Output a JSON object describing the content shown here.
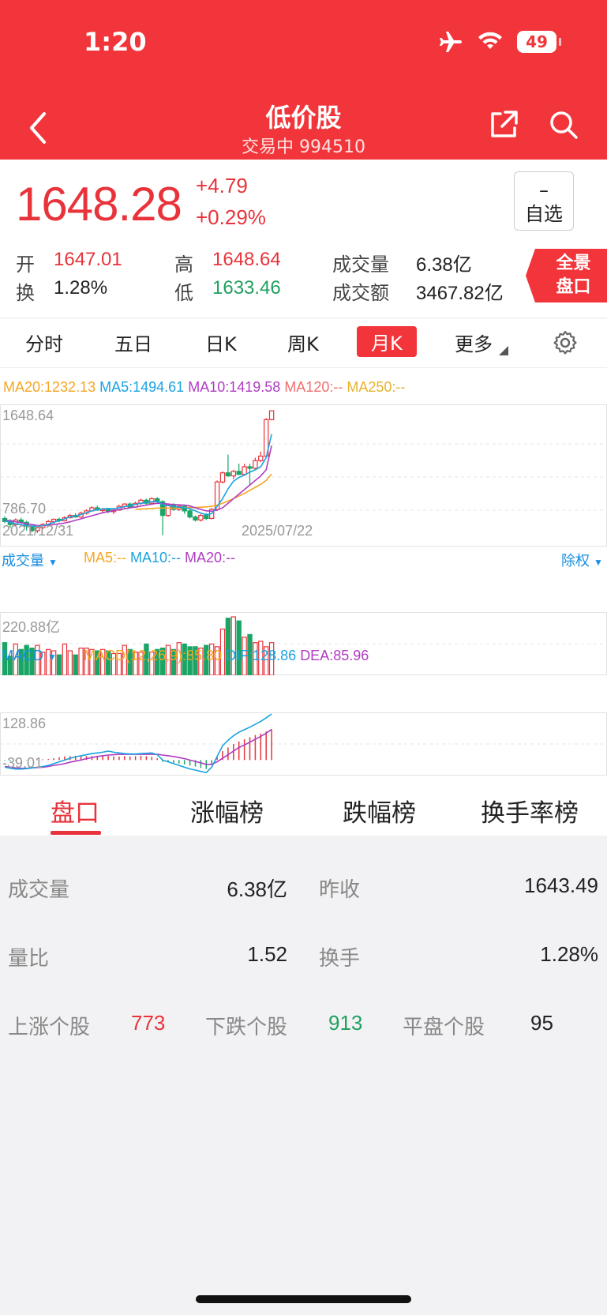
{
  "status": {
    "time": "1:20",
    "battery": "49"
  },
  "header": {
    "title": "低价股",
    "subtitle": "交易中 994510"
  },
  "quote": {
    "price": "1648.28",
    "change": "+4.79",
    "change_pct": "+0.29%",
    "watch_symbol": "–",
    "watch_label": "自选",
    "open_label": "开",
    "open": "1647.01",
    "turnover_label": "换",
    "turnover": "1.28%",
    "high_label": "高",
    "high": "1648.64",
    "low_label": "低",
    "low": "1633.46",
    "volume_label": "成交量",
    "volume": "6.38亿",
    "amount_label": "成交额",
    "amount": "3467.82亿",
    "panorama_line1": "全景",
    "panorama_line2": "盘口"
  },
  "tabs": [
    "分时",
    "五日",
    "日K",
    "周K",
    "月K",
    "更多"
  ],
  "active_tab": "月K",
  "chart_data": [
    {
      "type": "candlestick",
      "legend": [
        {
          "text": "MA20:1232.13",
          "color": "#f5a623"
        },
        {
          "text": "MA5:1494.61",
          "color": "#1aa3e0"
        },
        {
          "text": "MA10:1419.58",
          "color": "#b03cc2"
        },
        {
          "text": "MA120:--",
          "color": "#f07070"
        },
        {
          "text": "MA250:--",
          "color": "#e8b22c"
        }
      ],
      "y_max_label": "1648.64",
      "y_min_label": "786.70",
      "x_start": "2021/12/31",
      "x_end": "2025/07/22",
      "ylim": [
        786.7,
        1648.64
      ],
      "candles": [
        [
          940,
          920,
          955,
          910
        ],
        [
          925,
          900,
          935,
          880
        ],
        [
          900,
          930,
          940,
          890
        ],
        [
          930,
          915,
          945,
          905
        ],
        [
          915,
          890,
          925,
          860
        ],
        [
          890,
          860,
          900,
          850
        ],
        [
          860,
          880,
          890,
          845
        ],
        [
          880,
          900,
          910,
          870
        ],
        [
          900,
          920,
          930,
          895
        ],
        [
          920,
          935,
          940,
          905
        ],
        [
          935,
          925,
          945,
          915
        ],
        [
          925,
          945,
          955,
          920
        ],
        [
          945,
          960,
          970,
          940
        ],
        [
          960,
          950,
          975,
          945
        ],
        [
          950,
          975,
          985,
          945
        ],
        [
          975,
          990,
          1000,
          965
        ],
        [
          990,
          1010,
          1020,
          985
        ],
        [
          1010,
          995,
          1025,
          990
        ],
        [
          995,
          1000,
          1010,
          980
        ],
        [
          1000,
          985,
          1010,
          975
        ],
        [
          985,
          995,
          1005,
          970
        ],
        [
          995,
          1020,
          1030,
          990
        ],
        [
          1020,
          1035,
          1040,
          1005
        ],
        [
          1035,
          1015,
          1045,
          1010
        ],
        [
          1015,
          1040,
          1050,
          1010
        ],
        [
          1040,
          1060,
          1070,
          1030
        ],
        [
          1060,
          1040,
          1070,
          1030
        ],
        [
          1040,
          1070,
          1080,
          1035
        ],
        [
          1070,
          1050,
          1080,
          1040
        ],
        [
          1050,
          960,
          1060,
          830
        ],
        [
          960,
          1030,
          1040,
          950
        ],
        [
          1030,
          1000,
          1040,
          990
        ],
        [
          1000,
          1020,
          1030,
          990
        ],
        [
          1020,
          990,
          1030,
          970
        ],
        [
          990,
          950,
          1000,
          940
        ],
        [
          950,
          930,
          960,
          920
        ],
        [
          930,
          960,
          970,
          920
        ],
        [
          960,
          940,
          975,
          930
        ],
        [
          940,
          1000,
          1010,
          935
        ],
        [
          1000,
          1180,
          1190,
          990
        ],
        [
          1180,
          1240,
          1250,
          1170
        ],
        [
          1240,
          1220,
          1360,
          1215
        ],
        [
          1220,
          1250,
          1260,
          1200
        ],
        [
          1250,
          1230,
          1300,
          1225
        ],
        [
          1230,
          1280,
          1300,
          1220
        ],
        [
          1280,
          1270,
          1300,
          1160
        ],
        [
          1270,
          1320,
          1340,
          1260
        ],
        [
          1320,
          1350,
          1380,
          1310
        ],
        [
          1350,
          1590,
          1600,
          1340
        ],
        [
          1590,
          1648,
          1649,
          1585
        ]
      ],
      "ma5": [
        925,
        915,
        905,
        898,
        895,
        890,
        888,
        893,
        902,
        915,
        925,
        938,
        950,
        958,
        965,
        978,
        990,
        998,
        1003,
        1005,
        1004,
        1010,
        1018,
        1025,
        1032,
        1040,
        1045,
        1050,
        1055,
        1030,
        1025,
        1018,
        1015,
        1010,
        1005,
        990,
        975,
        965,
        972,
        1020,
        1070,
        1135,
        1185,
        1210,
        1225,
        1245,
        1260,
        1280,
        1340,
        1494.61
      ],
      "ma10": [
        930,
        925,
        918,
        912,
        905,
        900,
        895,
        894,
        896,
        900,
        905,
        910,
        918,
        928,
        938,
        948,
        958,
        968,
        978,
        985,
        992,
        998,
        1004,
        1010,
        1015,
        1022,
        1028,
        1034,
        1040,
        1038,
        1035,
        1032,
        1030,
        1028,
        1022,
        1010,
        1000,
        990,
        988,
        995,
        1010,
        1040,
        1070,
        1100,
        1130,
        1160,
        1190,
        1220,
        1260,
        1419.58
      ],
      "ma20": [
        null,
        null,
        null,
        null,
        null,
        null,
        null,
        null,
        null,
        null,
        null,
        null,
        null,
        null,
        null,
        null,
        null,
        null,
        null,
        null,
        null,
        null,
        null,
        null,
        1000,
        1002,
        1004,
        1006,
        1008,
        1008,
        1008,
        1008,
        1010,
        1012,
        1012,
        1012,
        1014,
        1016,
        1020,
        1028,
        1040,
        1055,
        1070,
        1088,
        1105,
        1125,
        1145,
        1165,
        1190,
        1232.13
      ]
    },
    {
      "type": "bar",
      "title": "成交量",
      "legend": [
        {
          "text": "MA5:--",
          "color": "#f5a623"
        },
        {
          "text": "MA10:--",
          "color": "#1aa3e0"
        },
        {
          "text": "MA20:--",
          "color": "#b03cc2"
        }
      ],
      "right_label": "除权",
      "y_max_label": "220.88亿",
      "ylim": [
        0,
        220.88
      ],
      "values": [
        120,
        70,
        115,
        95,
        110,
        100,
        110,
        85,
        95,
        90,
        75,
        115,
        90,
        75,
        100,
        100,
        95,
        90,
        95,
        90,
        80,
        80,
        110,
        95,
        85,
        85,
        115,
        85,
        95,
        100,
        110,
        95,
        120,
        115,
        105,
        105,
        100,
        110,
        115,
        105,
        170,
        210,
        215,
        200,
        140,
        150,
        120,
        125,
        105,
        120
      ]
    },
    {
      "type": "bar",
      "title": "MACD",
      "legend": [
        {
          "text": "MACD(12,26,9):85.80",
          "color": "#f5a623"
        },
        {
          "text": "DIF:128.86",
          "color": "#1aa3e0"
        },
        {
          "text": "DEA:85.96",
          "color": "#b03cc2"
        }
      ],
      "y_max_label": "128.86",
      "y_min_label": "-39.01",
      "ylim": [
        -39.01,
        128.86
      ],
      "values": [
        -2,
        -3,
        -2,
        -1,
        -1,
        0,
        1,
        2,
        3,
        5,
        8,
        10,
        11,
        12,
        12,
        11,
        11,
        12,
        11,
        12,
        10,
        10,
        11,
        10,
        11,
        12,
        11,
        9,
        5,
        -5,
        -6,
        -8,
        -10,
        -12,
        -15,
        -18,
        -22,
        -25,
        -12,
        10,
        25,
        35,
        45,
        52,
        58,
        64,
        70,
        74,
        80,
        85.8
      ],
      "dif": [
        -20,
        -23,
        -25,
        -25,
        -24,
        -22,
        -20,
        -18,
        -15,
        -10,
        -5,
        0,
        5,
        9,
        12,
        15,
        18,
        20,
        22,
        25,
        22,
        20,
        18,
        17,
        17,
        18,
        19,
        20,
        15,
        0,
        -5,
        -10,
        -15,
        -20,
        -25,
        -28,
        -32,
        -35,
        -20,
        10,
        40,
        55,
        68,
        78,
        85,
        92,
        100,
        108,
        118,
        128.86
      ],
      "dea": [
        -18,
        -20,
        -22,
        -23,
        -23,
        -22,
        -21,
        -20,
        -18,
        -15,
        -13,
        -10,
        -6,
        -3,
        0,
        4,
        7,
        10,
        12,
        14,
        15,
        16,
        16,
        16,
        16,
        16,
        16,
        16,
        16,
        14,
        12,
        10,
        7,
        4,
        0,
        -4,
        -8,
        -12,
        -12,
        -5,
        5,
        15,
        25,
        35,
        42,
        50,
        58,
        66,
        75,
        85.96
      ]
    }
  ],
  "section_tabs": [
    "盘口",
    "涨幅榜",
    "跌幅榜",
    "换手率榜"
  ],
  "info": {
    "volume_label": "成交量",
    "volume": "6.38亿",
    "prev_close_label": "昨收",
    "prev_close": "1643.49",
    "ratio_label": "量比",
    "ratio": "1.52",
    "turnover_label": "换手",
    "turnover": "1.28%",
    "up_label": "上涨个股",
    "up": "773",
    "down_label": "下跌个股",
    "down": "913",
    "flat_label": "平盘个股",
    "flat": "95"
  },
  "colors": {
    "up": "#e8333a",
    "down": "#1aa566",
    "brand": "#f2353a"
  }
}
